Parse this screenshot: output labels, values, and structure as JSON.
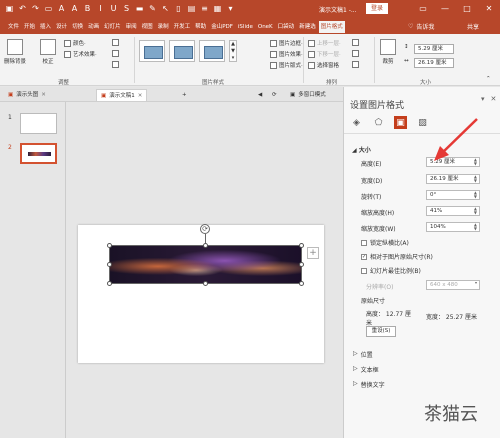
{
  "titlebar": {
    "title": "演示文稿1 -...",
    "login": "登录",
    "min": "—",
    "max": "□",
    "close": "✕"
  },
  "tabs": [
    "文件",
    "开始",
    "插入",
    "设计",
    "切换",
    "动画",
    "幻灯片",
    "审阅",
    "视图",
    "录制",
    "开发工",
    "帮助",
    "金山PDF",
    "iSlide",
    "OneK",
    "口袋动",
    "新建选",
    "图片格式"
  ],
  "active_tab": "图片格式",
  "tellme": "告诉我",
  "share": "共享",
  "ribbon": {
    "remove_bg": "删除背景",
    "correct": "校正",
    "color": "颜色·",
    "artistic": "艺术效果·",
    "adjust_group": "调整",
    "styles_group": "图片样式",
    "border": "图片边框·",
    "effects": "图片效果·",
    "layout": "图片版式·",
    "bring_forward": "上移一层·",
    "send_backward": "下移一层·",
    "selection_pane": "选择窗格",
    "arrange_group": "排列",
    "crop": "裁剪",
    "height": "5.29 厘米",
    "width": "26.19 厘米",
    "size_group": "大小"
  },
  "doctabs": [
    {
      "label": "演示头图"
    },
    {
      "label": "演示文稿1"
    },
    {
      "label": "多窗口模式"
    }
  ],
  "slides": [
    "1",
    "2"
  ],
  "pane": {
    "title": "设置图片格式",
    "section_size": "大小",
    "height_label": "高度(E)",
    "height_value": "5.29 厘米",
    "width_label": "宽度(D)",
    "width_value": "26.19 厘米",
    "rotation_label": "旋转(T)",
    "rotation_value": "0°",
    "scale_h_label": "缩放高度(H)",
    "scale_h_value": "41%",
    "scale_w_label": "缩放宽度(W)",
    "scale_w_value": "104%",
    "lock_aspect": "锁定纵横比(A)",
    "relative_original": "相对于图片原始尺寸(R)",
    "best_scale": "幻灯片最佳比例(B)",
    "resolution_label": "分辨率(O)",
    "resolution_value": "640 x 480",
    "original_size": "原始尺寸",
    "orig_height": "高度：  12.77 厘米",
    "orig_width": "宽度：  25.27 厘米",
    "reset": "重设(S)",
    "position": "位置",
    "textbox": "文本框",
    "alt_text": "替换文字"
  },
  "watermark": "茶猫云",
  "colors": {
    "accent": "#b7472a",
    "arrow": "#e53935"
  }
}
